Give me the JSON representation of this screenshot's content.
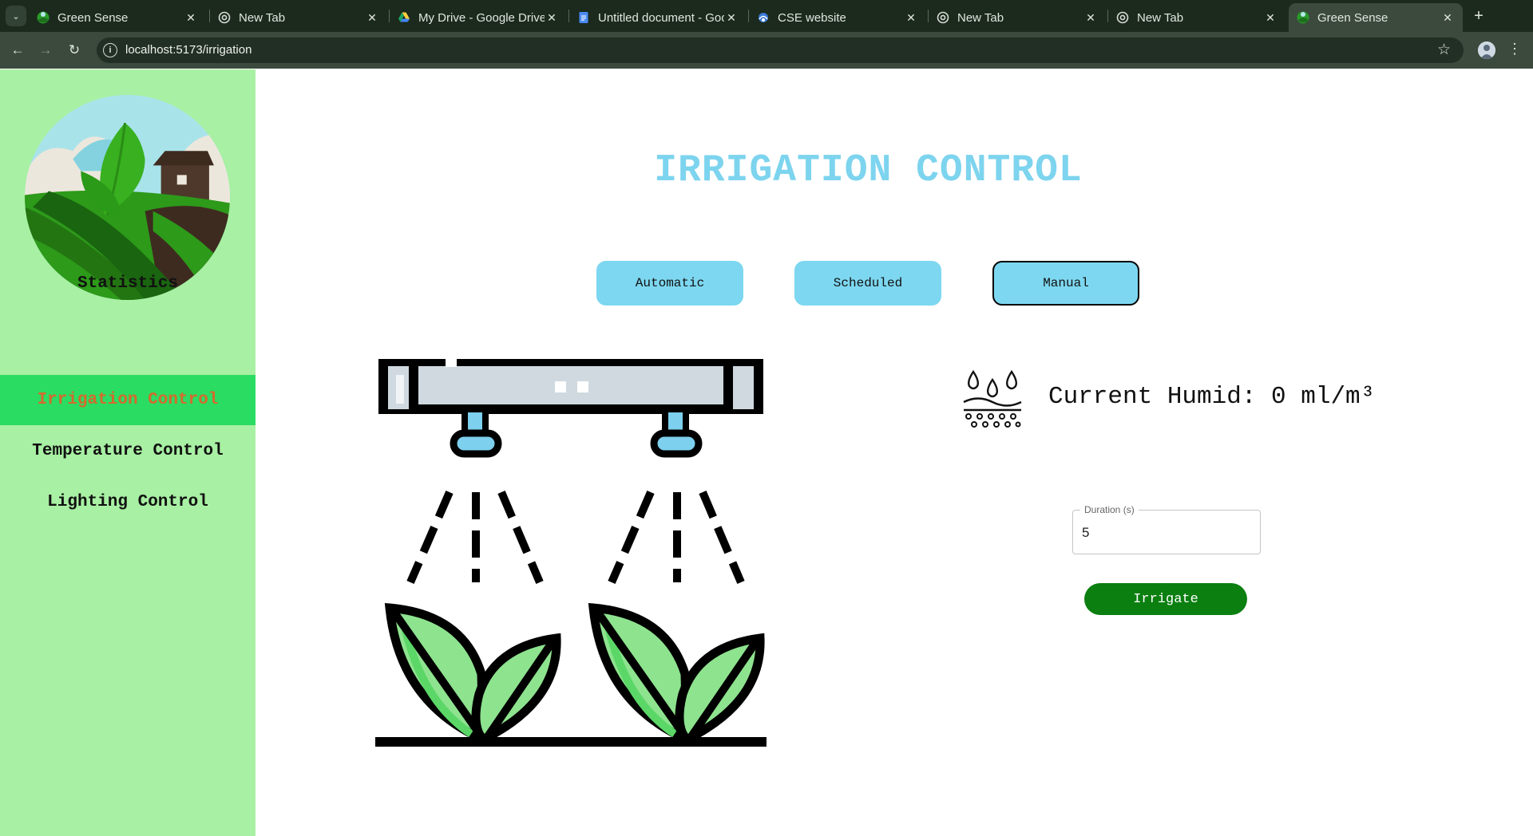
{
  "browser": {
    "tabs": [
      {
        "title": "Green Sense",
        "icon": "green-sense-favicon"
      },
      {
        "title": "New Tab",
        "icon": "chrome-favicon"
      },
      {
        "title": "My Drive - Google Drive",
        "icon": "google-drive-favicon"
      },
      {
        "title": "Untitled document - Google Docs",
        "icon": "google-docs-favicon"
      },
      {
        "title": "CSE website",
        "icon": "cse-favicon"
      },
      {
        "title": "New Tab",
        "icon": "chrome-favicon"
      },
      {
        "title": "New Tab",
        "icon": "chrome-favicon"
      },
      {
        "title": "Green Sense",
        "icon": "green-sense-favicon",
        "active": true
      }
    ],
    "url": "localhost:5173/irrigation"
  },
  "sidebar": {
    "items": [
      {
        "label": "Statistics",
        "active": false
      },
      {
        "label": "Irrigation Control",
        "active": true
      },
      {
        "label": "Temperature Control",
        "active": false
      },
      {
        "label": "Lighting Control",
        "active": false
      }
    ]
  },
  "main": {
    "title": "IRRIGATION CONTROL",
    "modes": [
      {
        "label": "Automatic",
        "selected": false
      },
      {
        "label": "Scheduled",
        "selected": false
      },
      {
        "label": "Manual",
        "selected": true
      }
    ],
    "humidity_text": "Current Humid: 0 ml/m³",
    "duration_label": "Duration (s)",
    "duration_value": "5",
    "irrigate_label": "Irrigate"
  },
  "colors": {
    "sidebar_bg": "#a8f0a3",
    "active_nav_bg": "#2bdc62",
    "active_nav_text": "#d46a2d",
    "title": "#7dd4ee",
    "mode_button": "#7dd7f0",
    "irrigate_button": "#0b7f10"
  }
}
